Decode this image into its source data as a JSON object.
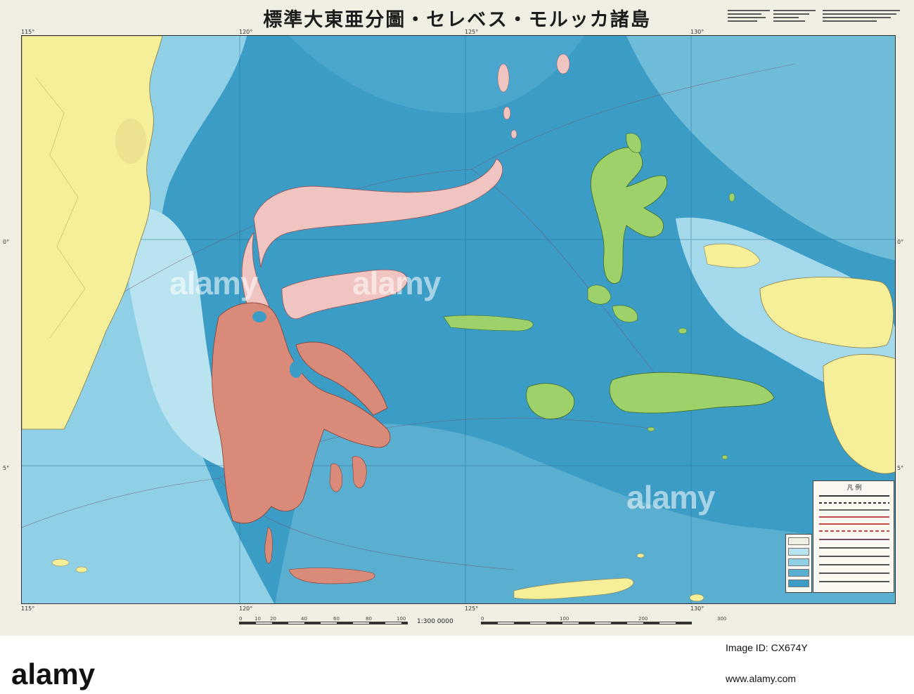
{
  "map": {
    "title": "標準大東亜分圖・セレベス・モルッカ諸島",
    "scale_ratio": "1:300 0000",
    "longitude_ticks": [
      "115°",
      "120°",
      "125°",
      "130°"
    ],
    "latitude_ticks": [
      "0°",
      "5°"
    ],
    "scale_left_ticks": [
      "0",
      "10",
      "20",
      "40",
      "60",
      "80",
      "100"
    ],
    "scale_right_ticks": [
      "0",
      "100",
      "200",
      "300"
    ],
    "colors": {
      "deep_sea": "#3b9cc6",
      "shallow_sea": "#8fd0e6",
      "coast_sea": "#b9e4ef",
      "celebes": "#d98a78",
      "celebes_north": "#f0c4c0",
      "moluccas": "#9fd16a",
      "borneo_newguinea": "#f5ef9a",
      "paper": "#f1eee4"
    }
  },
  "legend": {
    "title": "凡 例"
  },
  "watermark": {
    "text": "alamy"
  },
  "footer": {
    "logo": "alamy",
    "image_id": "Image ID: CX674Y",
    "url": "www.alamy.com"
  }
}
